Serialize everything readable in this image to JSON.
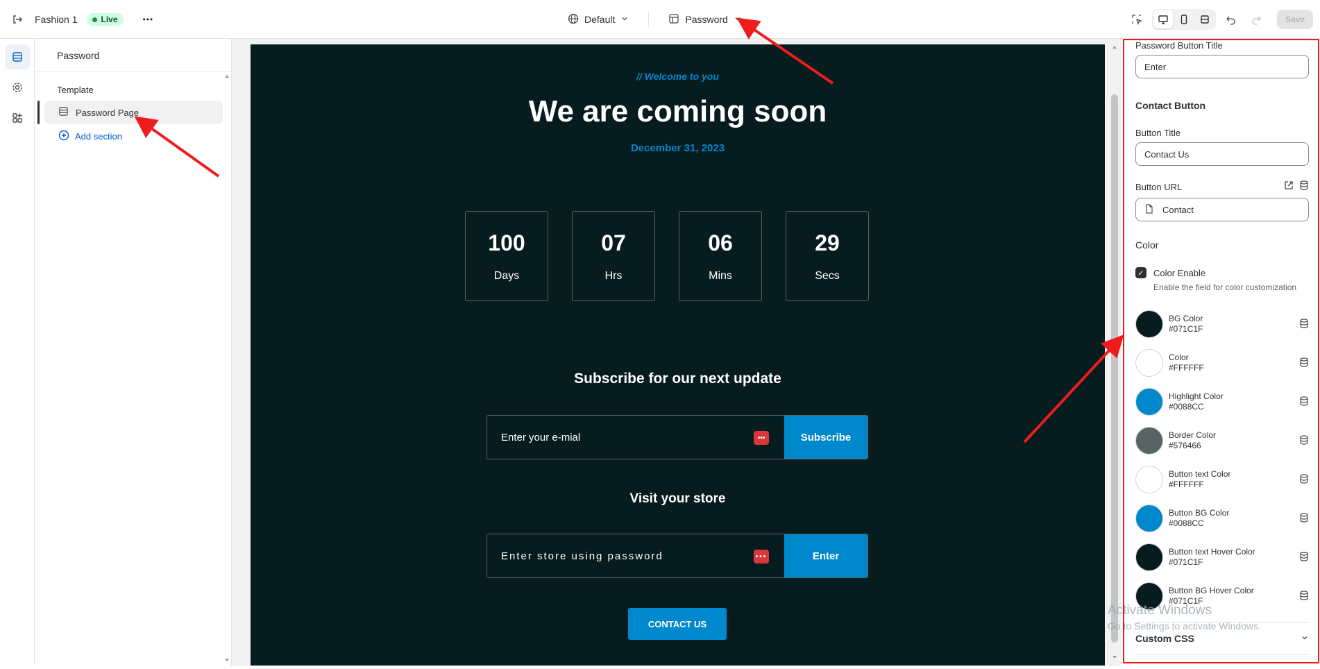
{
  "topbar": {
    "store_name": "Fashion 1",
    "live_label": "Live",
    "more_label": "•••",
    "theme_dropdown": "Default",
    "page_dropdown": "Password",
    "save_label": "Save"
  },
  "sidebar": {
    "header": "Password",
    "section_title": "Template",
    "item_label": "Password Page",
    "add_section_label": "Add section"
  },
  "preview": {
    "welcome": "// Welcome to you",
    "headline": "We are coming soon",
    "date": "December 31, 2023",
    "countdown": [
      {
        "value": "100",
        "label": "Days"
      },
      {
        "value": "07",
        "label": "Hrs"
      },
      {
        "value": "06",
        "label": "Mins"
      },
      {
        "value": "29",
        "label": "Secs"
      }
    ],
    "subscribe_title": "Subscribe for our next update",
    "email_placeholder": "Enter your e-mial",
    "subscribe_button": "Subscribe",
    "visit_title": "Visit your store",
    "password_placeholder": "Enter store using password",
    "enter_button": "Enter",
    "contact_button": "CONTACT US"
  },
  "panel": {
    "password_button_title_label": "Password Button Title",
    "password_button_title_value": "Enter",
    "contact_heading": "Contact Button",
    "button_title_label": "Button Title",
    "button_title_value": "Contact Us",
    "button_url_label": "Button URL",
    "button_url_value": "Contact",
    "color_heading": "Color",
    "color_enable_label": "Color Enable",
    "color_enable_help": "Enable the field for color customization",
    "colors": [
      {
        "name": "BG Color",
        "hex": "#071C1F",
        "swatch": "#071c1f"
      },
      {
        "name": "Color",
        "hex": "#FFFFFF",
        "swatch": "#ffffff"
      },
      {
        "name": "Highlight Color",
        "hex": "#0088CC",
        "swatch": "#0088cc"
      },
      {
        "name": "Border Color",
        "hex": "#576466",
        "swatch": "#576466"
      },
      {
        "name": "Button text Color",
        "hex": "#FFFFFF",
        "swatch": "#ffffff"
      },
      {
        "name": "Button BG Color",
        "hex": "#0088CC",
        "swatch": "#0088cc"
      },
      {
        "name": "Button text Hover Color",
        "hex": "#071C1F",
        "swatch": "#071c1f"
      },
      {
        "name": "Button BG Hover Color",
        "hex": "#071C1F",
        "swatch": "#071c1f"
      }
    ],
    "custom_css_label": "Custom CSS"
  },
  "watermark": {
    "title": "Activate Windows",
    "subtitle": "Go to Settings to activate Windows."
  },
  "annotation_color": "#ee1c1c"
}
